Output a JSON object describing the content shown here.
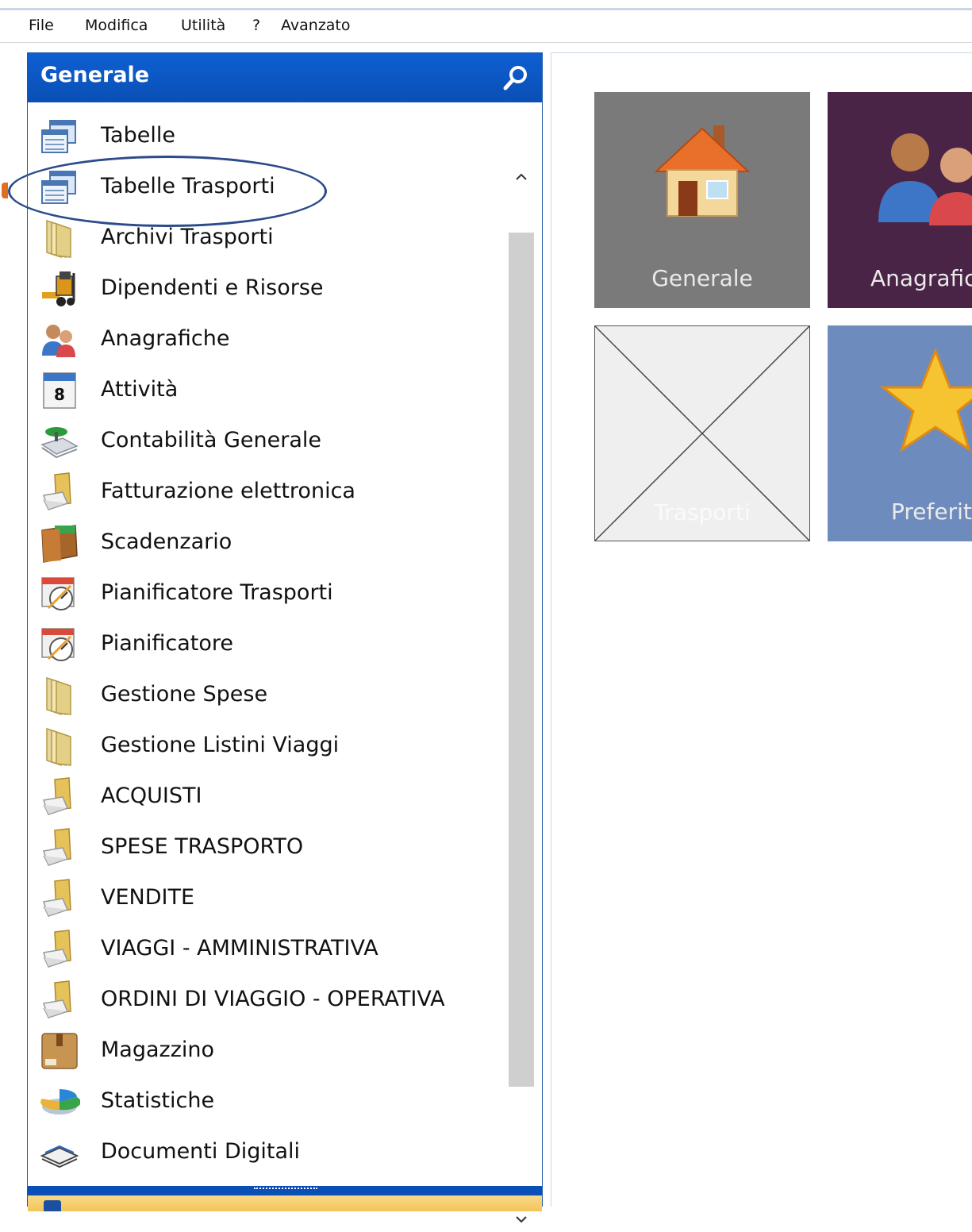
{
  "menubar": {
    "items": [
      {
        "label": "File"
      },
      {
        "label": "Modifica"
      },
      {
        "label": "Utilità"
      },
      {
        "label": "?"
      },
      {
        "label": "Avanzato"
      }
    ]
  },
  "navigation_panel": {
    "title": "Generale",
    "items": [
      {
        "label": "Tabelle",
        "icon": "table-icon"
      },
      {
        "label": "Tabelle Trasporti",
        "icon": "table-icon",
        "highlighted": true
      },
      {
        "label": "Archivi Trasporti",
        "icon": "folder-icon"
      },
      {
        "label": "Dipendenti e Risorse",
        "icon": "forklift-icon"
      },
      {
        "label": "Anagrafiche",
        "icon": "people-icon"
      },
      {
        "label": "Attività",
        "icon": "calendar-icon"
      },
      {
        "label": "Contabilità Generale",
        "icon": "accounting-icon"
      },
      {
        "label": "Fatturazione elettronica",
        "icon": "folder-document-icon"
      },
      {
        "label": "Scadenzario",
        "icon": "wallet-icon"
      },
      {
        "label": "Pianificatore Trasporti",
        "icon": "planner-icon"
      },
      {
        "label": "Pianificatore",
        "icon": "planner-icon"
      },
      {
        "label": "Gestione Spese",
        "icon": "folder-icon"
      },
      {
        "label": "Gestione Listini Viaggi",
        "icon": "folder-icon"
      },
      {
        "label": "ACQUISTI",
        "icon": "folder-document-icon"
      },
      {
        "label": "SPESE TRASPORTO",
        "icon": "folder-document-icon"
      },
      {
        "label": "VENDITE",
        "icon": "folder-document-icon"
      },
      {
        "label": "VIAGGI - AMMINISTRATIVA",
        "icon": "folder-document-icon"
      },
      {
        "label": "ORDINI DI VIAGGIO - OPERATIVA",
        "icon": "folder-document-icon"
      },
      {
        "label": "Magazzino",
        "icon": "box-icon"
      },
      {
        "label": "Statistiche",
        "icon": "pie-chart-icon"
      },
      {
        "label": "Documenti Digitali",
        "icon": "stack-icon"
      }
    ]
  },
  "tiles": [
    {
      "label": "Generale",
      "icon": "house-icon",
      "color": "#7a7a7a"
    },
    {
      "label": "Anagrafic",
      "icon": "people-icon",
      "color": "#4a2446"
    },
    {
      "label": "Trasporti",
      "icon": "placeholder-x-icon",
      "color": "#efefef"
    },
    {
      "label": "Preferit",
      "icon": "star-icon",
      "color": "#6e8bbd"
    }
  ],
  "colors": {
    "panel_header": "#0a4fb5",
    "annotation_ellipse": "#2b4b8a"
  }
}
